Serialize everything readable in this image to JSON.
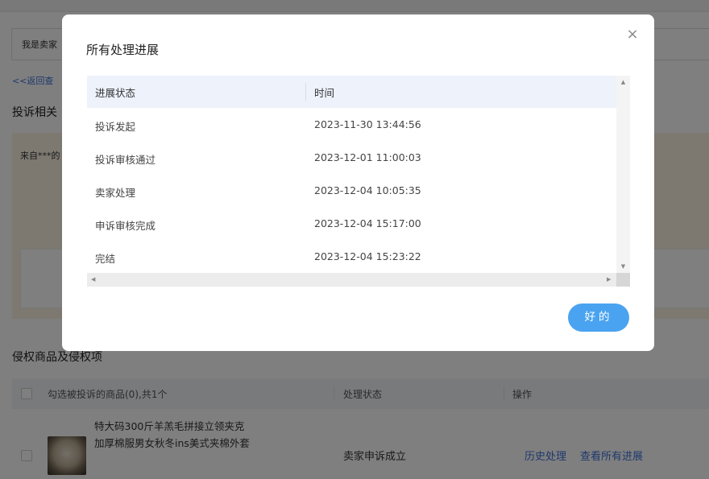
{
  "background": {
    "seller_role": "我是卖家",
    "back_link": "<<返回查",
    "complaint_section_title": "投诉相关",
    "complaint_from": "来自***的",
    "goods_section_title": "侵权商品及侵权项",
    "goods_table": {
      "select_all_label": "勾选被投诉的商品(0),共1个",
      "columns": [
        "处理状态",
        "操作"
      ],
      "rows": [
        {
          "title": "特大码300斤羊羔毛拼接立领夹克加厚棉服男女秋冬ins美式夹棉外套",
          "status": "卖家申诉成立",
          "actions": [
            "历史处理",
            "查看所有进展"
          ]
        }
      ]
    }
  },
  "modal": {
    "title": "所有处理进展",
    "close_icon": "close-icon ×",
    "columns": [
      "进展状态",
      "时间"
    ],
    "rows": [
      {
        "status": "投诉发起",
        "time": "2023-11-30 13:44:56"
      },
      {
        "status": "投诉审核通过",
        "time": "2023-12-01 11:00:03"
      },
      {
        "status": "卖家处理",
        "time": "2023-12-04 10:05:35"
      },
      {
        "status": "申诉审核完成",
        "time": "2023-12-04 15:17:00"
      },
      {
        "status": "完结",
        "time": "2023-12-04 15:23:22"
      }
    ],
    "ok_label": "好的"
  },
  "colors": {
    "accent": "#4aa3f0",
    "link": "#3f73d8",
    "table_header_bg": "#edf2fb",
    "complaint_bg": "#fbf3e3"
  }
}
